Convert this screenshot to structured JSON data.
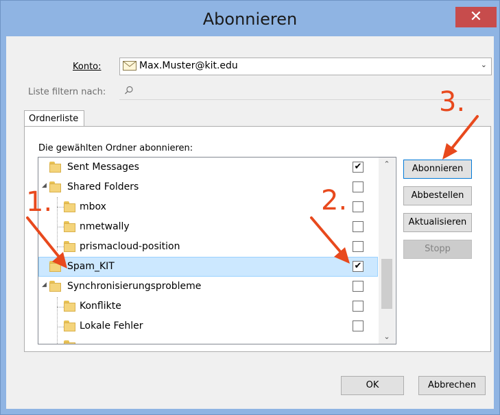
{
  "window": {
    "title": "Abonnieren",
    "close_symbol": "✕"
  },
  "konto": {
    "label": "Konto:",
    "value": "Max.Muster@kit.edu"
  },
  "filter": {
    "label": "Liste filtern nach:"
  },
  "tab": {
    "label": "Ordnerliste"
  },
  "list": {
    "caption": "Die gewählten Ordner abonnieren:",
    "items": [
      {
        "label": "Sent Messages",
        "checked": true
      },
      {
        "label": "Shared Folders",
        "checked": false
      },
      {
        "label": "mbox",
        "checked": false
      },
      {
        "label": "nmetwally",
        "checked": false
      },
      {
        "label": "prismacloud-position",
        "checked": false
      },
      {
        "label": "Spam_KIT",
        "checked": true,
        "selected": true
      },
      {
        "label": "Synchronisierungsprobleme",
        "checked": false
      },
      {
        "label": "Konflikte",
        "checked": false
      },
      {
        "label": "Lokale Fehler",
        "checked": false
      }
    ]
  },
  "buttons": {
    "subscribe": "Abonnieren",
    "unsubscribe": "Abbestellen",
    "refresh": "Aktualisieren",
    "stop": "Stopp",
    "ok": "OK",
    "cancel": "Abbrechen"
  },
  "annotations": {
    "one": "1.",
    "two": "2.",
    "three": "3.",
    "color": "#e8491d"
  },
  "check_mark": "✔"
}
